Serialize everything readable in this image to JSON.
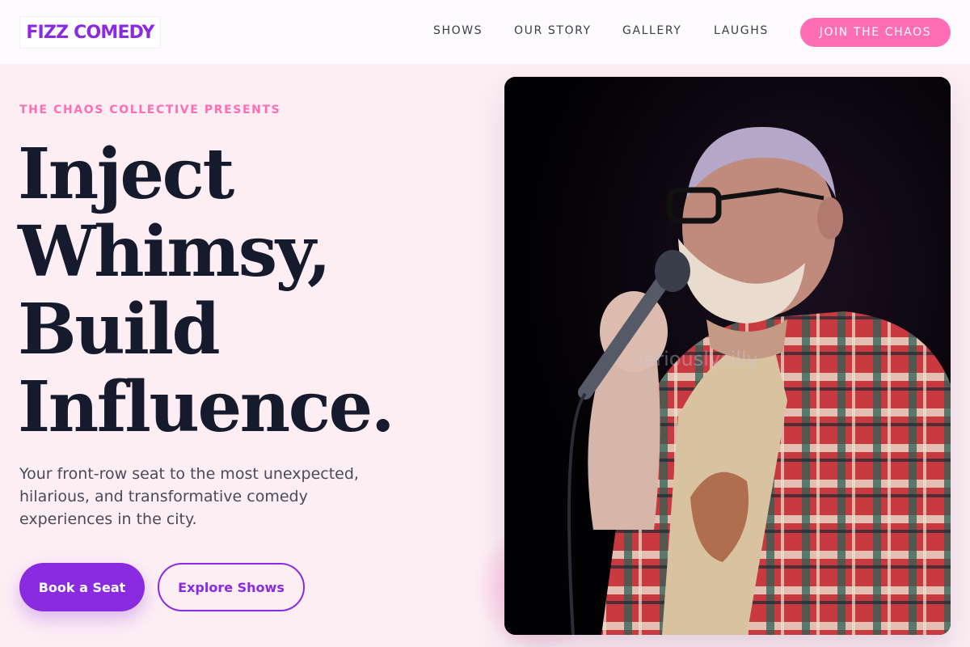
{
  "brand": {
    "name": "FIZZ COMEDY",
    "accent_color": "#8a2be2",
    "pink_color": "#ff6eb4"
  },
  "nav": {
    "links": [
      "SHOWS",
      "OUR STORY",
      "GALLERY",
      "LAUGHS"
    ],
    "cta_label": "JOIN THE CHAOS"
  },
  "hero": {
    "eyebrow": "THE CHAOS COLLECTIVE PRESENTS",
    "headline_lines": [
      "Inject",
      "Whimsy,",
      "Build",
      "Influence."
    ],
    "subtext": "Your front-row seat to the most unexpected, hilarious, and transformative comedy experiences in the city.",
    "primary_button": "Book a Seat",
    "secondary_button": "Explore Shows",
    "image_watermark": "seriouslysilly"
  }
}
